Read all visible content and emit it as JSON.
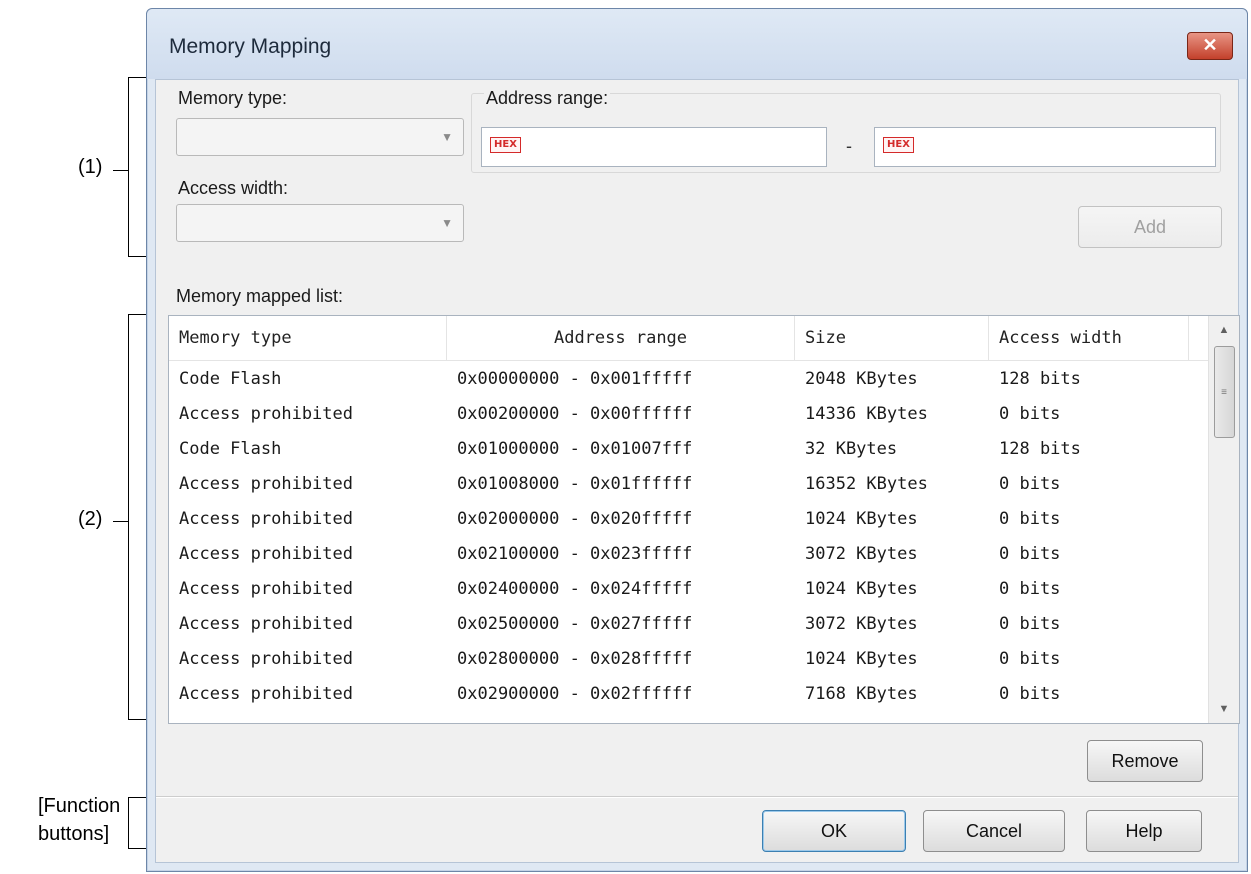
{
  "annotations": {
    "section1": "(1)",
    "section2": "(2)",
    "function_line1": "[Function",
    "function_line2": "buttons]"
  },
  "dialog": {
    "title": "Memory Mapping",
    "close_icon": "close-icon"
  },
  "form": {
    "memory_type_label": "Memory type:",
    "memory_type_value": "",
    "address_range_label": "Address range:",
    "address_start_value": "",
    "address_end_value": "",
    "hex_badge": "HEX",
    "address_separator": "-",
    "access_width_label": "Access width:",
    "access_width_value": "",
    "add_label": "Add"
  },
  "list": {
    "label": "Memory mapped list:",
    "columns": [
      "Memory type",
      "Address range",
      "Size",
      "Access width"
    ],
    "rows": [
      {
        "type": "Code Flash",
        "range": "0x00000000 - 0x001fffff",
        "size": "2048 KBytes",
        "width": "128 bits"
      },
      {
        "type": "Access prohibited",
        "range": "0x00200000 - 0x00ffffff",
        "size": "14336 KBytes",
        "width": "0 bits"
      },
      {
        "type": "Code Flash",
        "range": "0x01000000 - 0x01007fff",
        "size": "32 KBytes",
        "width": "128 bits"
      },
      {
        "type": "Access prohibited",
        "range": "0x01008000 - 0x01ffffff",
        "size": "16352 KBytes",
        "width": "0 bits"
      },
      {
        "type": "Access prohibited",
        "range": "0x02000000 - 0x020fffff",
        "size": "1024 KBytes",
        "width": "0 bits"
      },
      {
        "type": "Access prohibited",
        "range": "0x02100000 - 0x023fffff",
        "size": "3072 KBytes",
        "width": "0 bits"
      },
      {
        "type": "Access prohibited",
        "range": "0x02400000 - 0x024fffff",
        "size": "1024 KBytes",
        "width": "0 bits"
      },
      {
        "type": "Access prohibited",
        "range": "0x02500000 - 0x027fffff",
        "size": "3072 KBytes",
        "width": "0 bits"
      },
      {
        "type": "Access prohibited",
        "range": "0x02800000 - 0x028fffff",
        "size": "1024 KBytes",
        "width": "0 bits"
      },
      {
        "type": "Access prohibited",
        "range": "0x02900000 - 0x02ffffff",
        "size": "7168 KBytes",
        "width": "0 bits"
      }
    ],
    "remove_label": "Remove"
  },
  "buttons": {
    "ok": "OK",
    "cancel": "Cancel",
    "help": "Help"
  },
  "colors": {
    "close_button": "#c3402b",
    "hex_badge": "#d42a2a",
    "dialog_frame": "#dfe8f3"
  }
}
